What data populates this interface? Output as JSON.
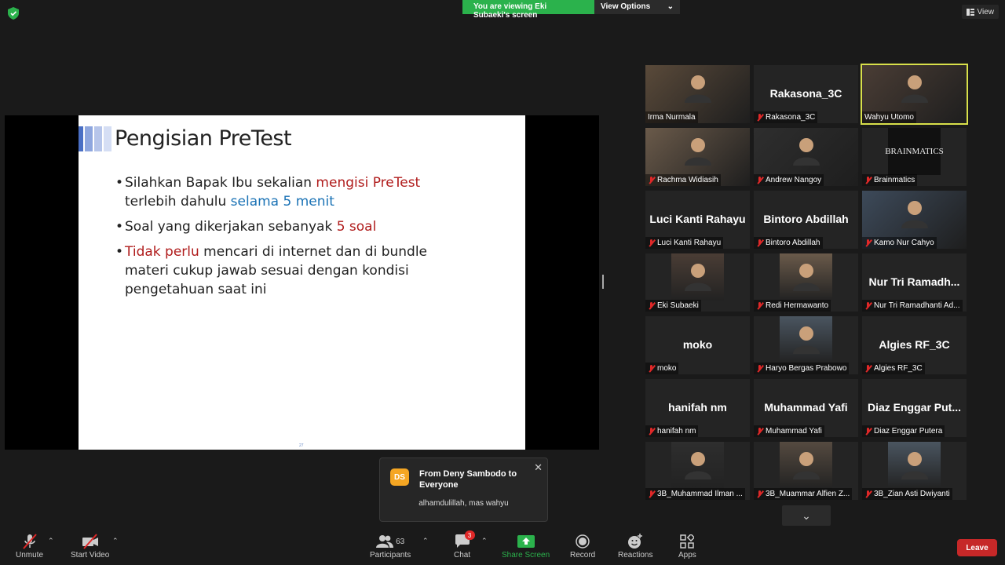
{
  "top": {
    "banner_text": "You are viewing Eki Subaeki's screen",
    "view_options_label": "View Options",
    "view_label": "View"
  },
  "slide": {
    "title": "Pengisian PreTest",
    "bullet1_a": "Silahkan Bapak Ibu sekalian ",
    "bullet1_b": "mengisi PreTest",
    "bullet1_c": "terlebih dahulu ",
    "bullet1_d": "selama 5 menit",
    "bullet2_a": "Soal yang dikerjakan sebanyak ",
    "bullet2_b": "5 soal",
    "bullet3_a": "Tidak perlu",
    "bullet3_b": " mencari di internet dan di bundle materi cukup jawab sesuai dengan kondisi pengetahuan saat ini",
    "page_number": "27"
  },
  "participants": [
    {
      "label": "Irma Nurmala",
      "big": "",
      "video": true,
      "muted": false
    },
    {
      "label": "Rakasona_3C",
      "big": "Rakasona_3C",
      "video": false,
      "muted": true
    },
    {
      "label": "Wahyu Utomo",
      "big": "",
      "video": true,
      "muted": false,
      "active": true
    },
    {
      "label": "Rachma Widiasih",
      "big": "",
      "video": true,
      "muted": true
    },
    {
      "label": "Andrew Nangoy",
      "big": "",
      "video": true,
      "muted": true
    },
    {
      "label": "Brainmatics",
      "big": "",
      "video": true,
      "muted": true
    },
    {
      "label": "Luci Kanti Rahayu",
      "big": "Luci Kanti Rahayu",
      "video": false,
      "muted": true
    },
    {
      "label": "Bintoro Abdillah",
      "big": "Bintoro Abdillah",
      "video": false,
      "muted": true
    },
    {
      "label": "Kamo Nur Cahyo",
      "big": "",
      "video": true,
      "muted": true
    },
    {
      "label": "Eki Subaeki",
      "big": "",
      "video": true,
      "muted": true
    },
    {
      "label": "Redi Hermawanto",
      "big": "",
      "video": true,
      "muted": true
    },
    {
      "label": "Nur Tri Ramadhanti Ad...",
      "big": "Nur Tri Ramadh...",
      "video": false,
      "muted": true
    },
    {
      "label": "moko",
      "big": "moko",
      "video": false,
      "muted": true
    },
    {
      "label": "Haryo Bergas Prabowo",
      "big": "",
      "video": true,
      "muted": true
    },
    {
      "label": "Algies RF_3C",
      "big": "Algies RF_3C",
      "video": false,
      "muted": true
    },
    {
      "label": "hanifah nm",
      "big": "hanifah nm",
      "video": false,
      "muted": true
    },
    {
      "label": "Muhammad Yafi",
      "big": "Muhammad Yafi",
      "video": false,
      "muted": true
    },
    {
      "label": "Diaz Enggar Putera",
      "big": "Diaz Enggar Put...",
      "video": false,
      "muted": true
    },
    {
      "label": "3B_Muhammad Ilman ...",
      "big": "",
      "video": true,
      "muted": true
    },
    {
      "label": "3B_Muammar Alfien Z...",
      "big": "",
      "video": true,
      "muted": true
    },
    {
      "label": "3B_Zian Asti Dwiyanti",
      "big": "",
      "video": true,
      "muted": true
    }
  ],
  "brand_tile_text": "BRAINMATICS",
  "chat": {
    "avatar": "DS",
    "from": "From Deny Sambodo to Everyone",
    "message": "alhamdulillah, mas wahyu"
  },
  "toolbar": {
    "unmute": "Unmute",
    "start_video": "Start Video",
    "participants": "Participants",
    "participants_count": "63",
    "chat": "Chat",
    "chat_badge": "3",
    "share_screen": "Share Screen",
    "record": "Record",
    "reactions": "Reactions",
    "apps": "Apps",
    "leave": "Leave"
  },
  "colors": {
    "accent_green": "#2bb24c",
    "leave_red": "#c62828",
    "active_speaker": "#d8e04a",
    "slide_red": "#b01c1c",
    "slide_blue": "#1a72b5"
  }
}
